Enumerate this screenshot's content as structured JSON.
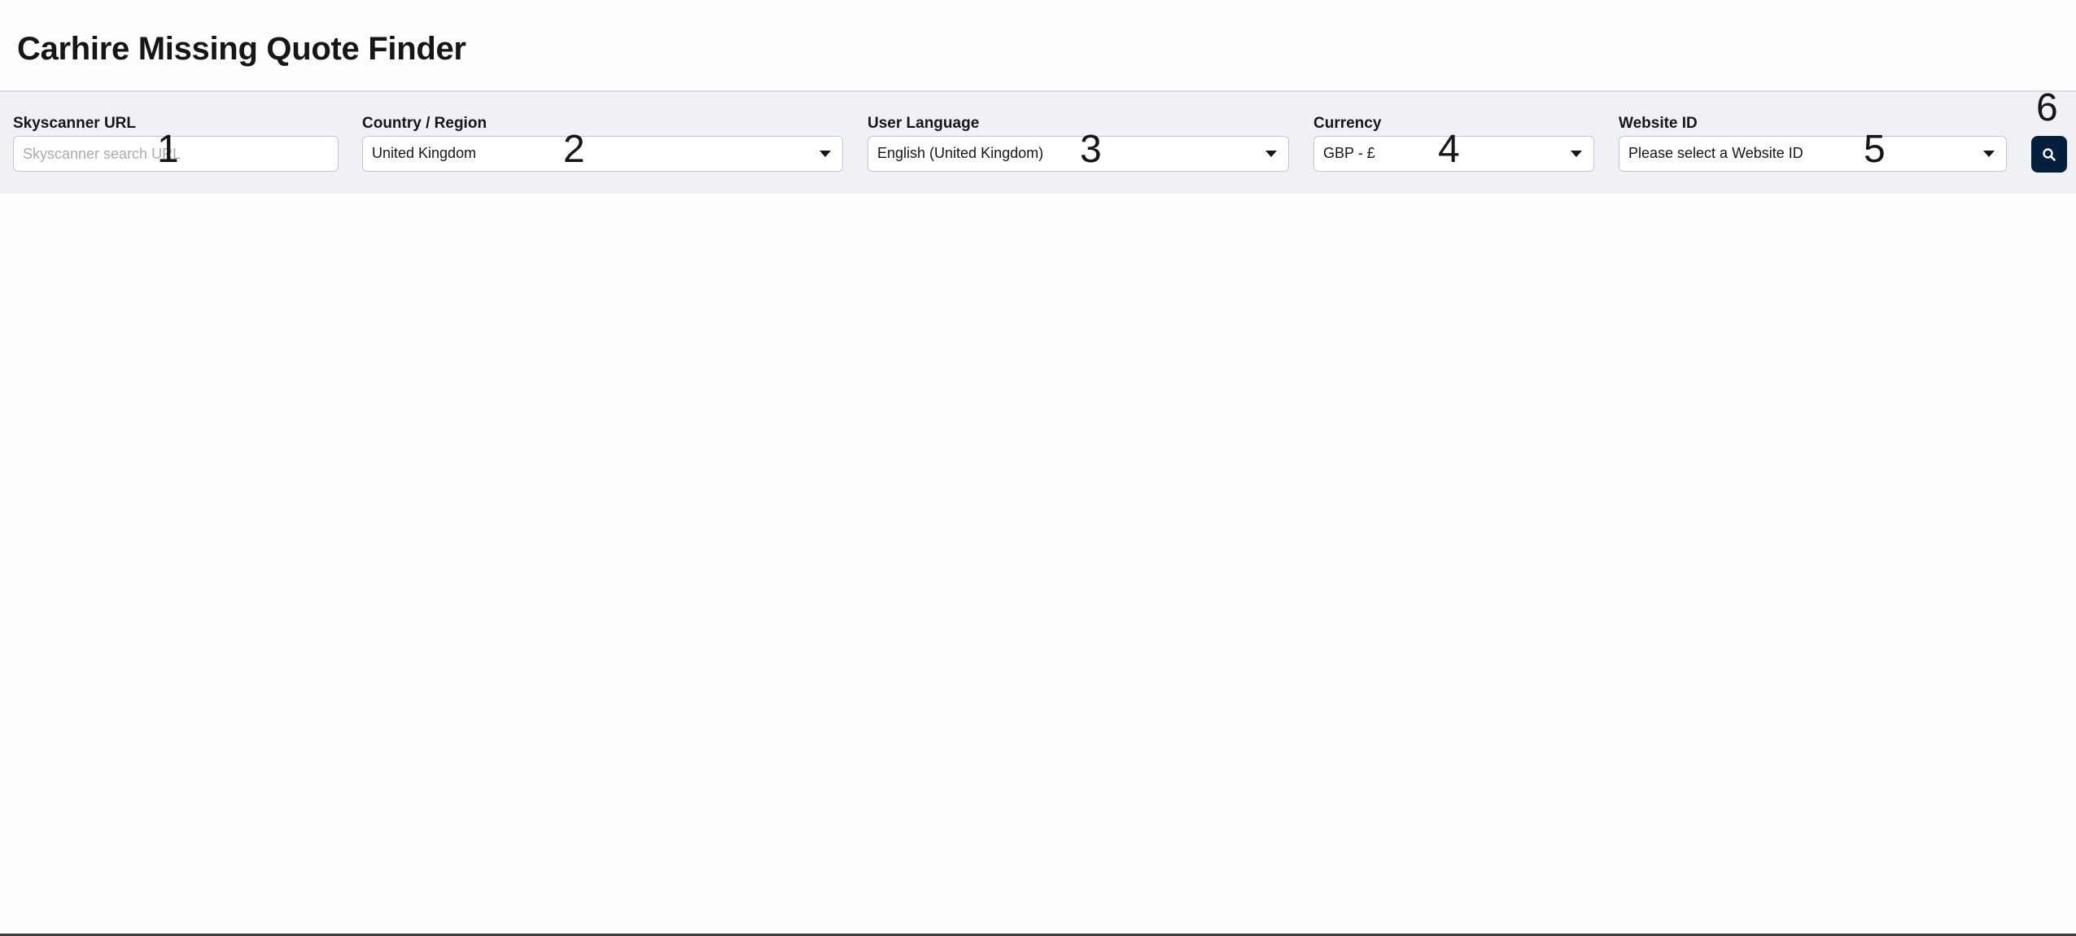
{
  "app": {
    "title": "Carhire Missing Quote Finder"
  },
  "form": {
    "skyscanner_url": {
      "label": "Skyscanner URL",
      "placeholder": "Skyscanner search URL",
      "value": ""
    },
    "country": {
      "label": "Country / Region",
      "value": "United Kingdom"
    },
    "language": {
      "label": "User Language",
      "value": "English (United Kingdom)"
    },
    "currency": {
      "label": "Currency",
      "value": "GBP - £"
    },
    "website_id": {
      "label": "Website ID",
      "value": "Please select a Website ID"
    },
    "search_button": {
      "icon": "search-icon"
    }
  },
  "annotations": [
    "1",
    "2",
    "3",
    "4",
    "5",
    "6"
  ],
  "colors": {
    "toolbar_bg": "#eff1f6",
    "button_bg": "#05203c",
    "text": "#161616"
  }
}
